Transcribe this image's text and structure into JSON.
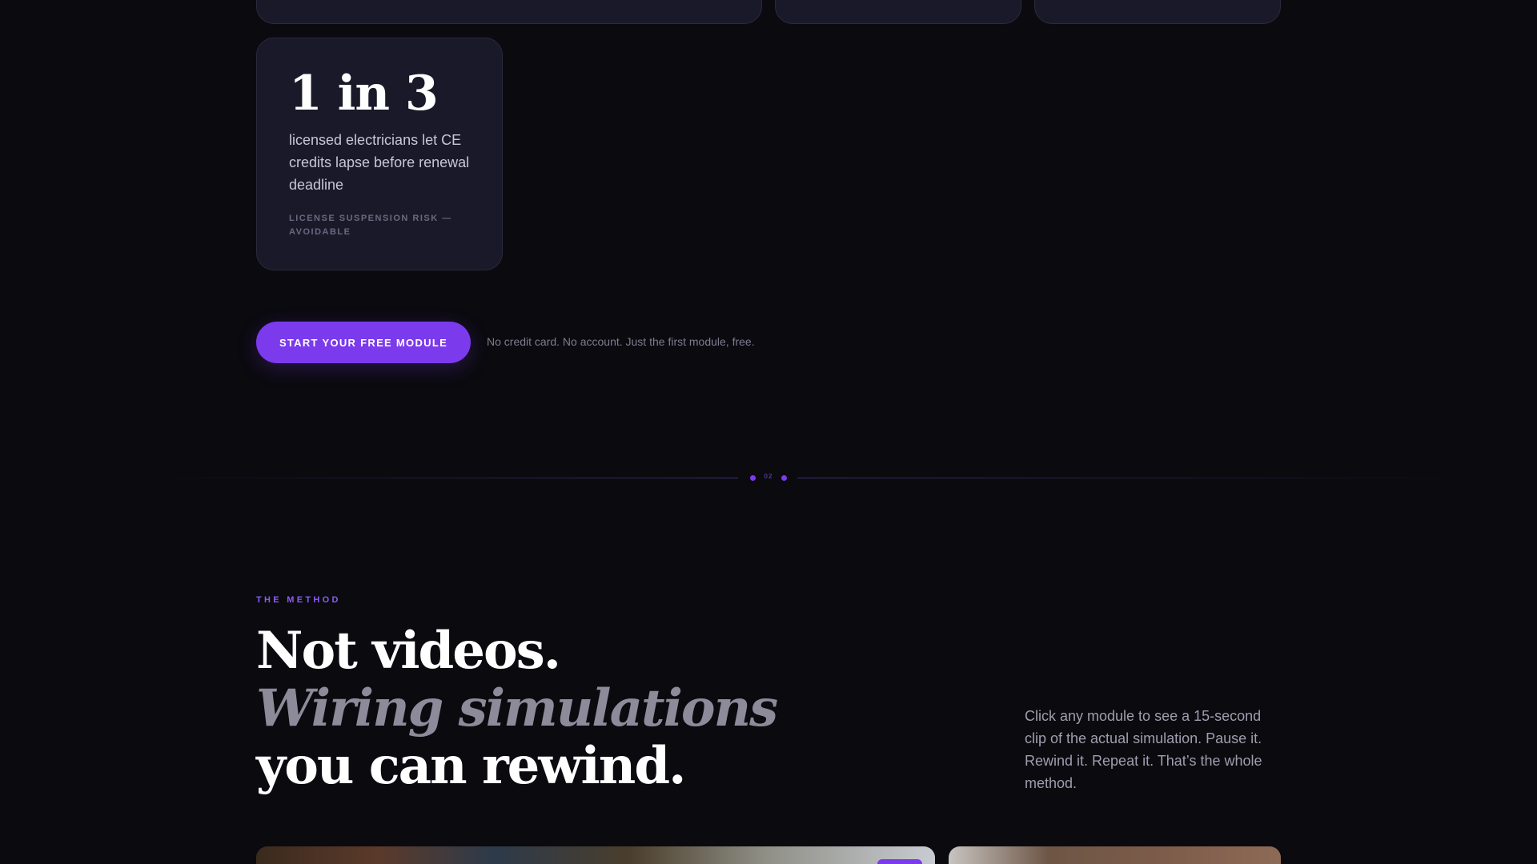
{
  "stat": {
    "number": "1 in 3",
    "description": "licensed electricians let CE credits lapse before renewal deadline",
    "footnote": "LICENSE SUSPENSION RISK — AVOIDABLE"
  },
  "cta": {
    "button_label": "START YOUR FREE MODULE",
    "note": "No credit card. No account. Just the first module, free."
  },
  "divider": {
    "number": "02"
  },
  "method": {
    "eyebrow": "THE METHOD",
    "headline_line1": "Not videos.",
    "headline_line2": "Wiring simulations",
    "headline_line3": "you can rewind.",
    "description": "Click any module to see a 15-second clip of the actual simulation. Pause it. Rewind it. Repeat it. That’s the whole method."
  },
  "colors": {
    "accent": "#7c3aed",
    "background": "#0b0a0f",
    "card": "#1a1929"
  }
}
